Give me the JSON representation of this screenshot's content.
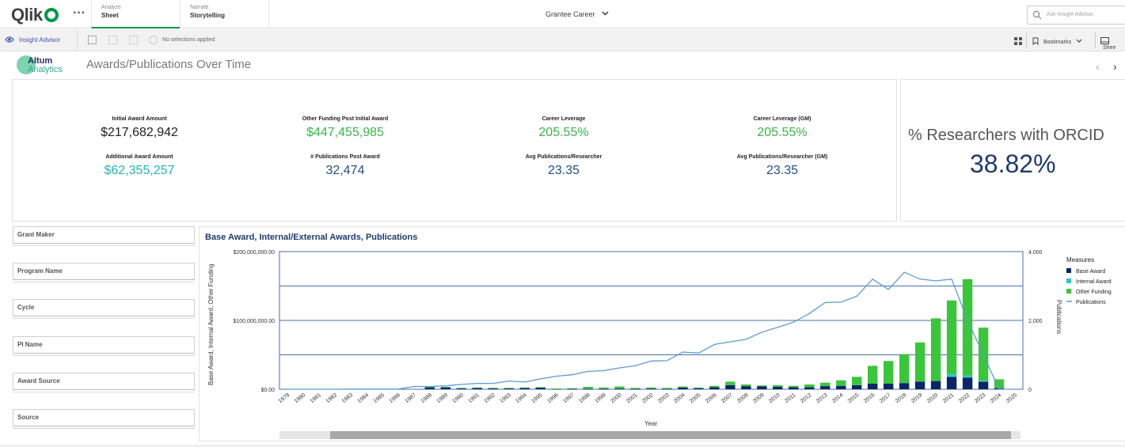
{
  "topbar": {
    "logo": "Qlik",
    "tabs": [
      {
        "small": "Analyze",
        "big": "Sheet"
      },
      {
        "small": "Narrate",
        "big": "Storytelling"
      }
    ],
    "app_title": "Grantee Career",
    "search_placeholder": "Ask Insight Advisor"
  },
  "toolbar": {
    "insight_advisor": "Insight Advisor",
    "no_selections": "No selections applied",
    "bookmarks": "Bookmarks",
    "sheets": "Shee"
  },
  "header": {
    "brand_line1": "Altum",
    "brand_line2": "Analytics",
    "sheet_title": "Awards/Publications Over Time"
  },
  "kpis": [
    {
      "label": "Initial Award Amount",
      "value": "$217,682,942",
      "color": "#222222"
    },
    {
      "label": "Other Funding Post Initial Award",
      "value": "$447,455,985",
      "color": "#3cb44b"
    },
    {
      "label": "Career Leverage",
      "value": "205.55%",
      "color": "#3cb44b"
    },
    {
      "label": "Career Leverage (GM)",
      "value": "205.55%",
      "color": "#3cb44b"
    },
    {
      "label": "Additional Award Amount",
      "value": "$62,355,257",
      "color": "#26b3b3"
    },
    {
      "label": "# Publications Post Award",
      "value": "32,474",
      "color": "#1f4e8c"
    },
    {
      "label": "Avg Publications/Researcher",
      "value": "23.35",
      "color": "#1f4e8c"
    },
    {
      "label": "Avg Publications/Researcher (GM)",
      "value": "23.35",
      "color": "#1f4e8c"
    }
  ],
  "orcid": {
    "label": "% Researchers with ORCID",
    "value": "38.82%"
  },
  "filters": [
    "Grant Maker",
    "Program Name",
    "Cycle",
    "PI Name",
    "Award Source",
    "Source"
  ],
  "chart_data": {
    "type": "bar",
    "title": "Base Award, Internal/External Awards, Publications",
    "xlabel": "Year",
    "ylabel": "Base Award, Internal Award, Other Funding",
    "y2label": "Publications",
    "y_ticks": [
      "$0.00",
      "$100,000,000.00",
      "$200,000,000.00"
    ],
    "y2_ticks": [
      "0",
      "2,000",
      "4,000"
    ],
    "ylim": [
      0,
      200000000
    ],
    "y2lim": [
      0,
      4000
    ],
    "legend_title": "Measures",
    "legend_position": "right",
    "categories": [
      "1979",
      "1980",
      "1981",
      "1982",
      "1983",
      "1984",
      "1985",
      "1986",
      "1987",
      "1988",
      "1989",
      "1990",
      "1991",
      "1992",
      "1993",
      "1994",
      "1995",
      "1996",
      "1997",
      "1998",
      "1999",
      "2000",
      "2001",
      "2002",
      "2003",
      "2004",
      "2005",
      "2006",
      "2007",
      "2008",
      "2009",
      "2010",
      "2011",
      "2012",
      "2013",
      "2014",
      "2015",
      "2016",
      "2017",
      "2018",
      "2019",
      "2020",
      "2021",
      "2022",
      "2023",
      "2024",
      "2025"
    ],
    "series": [
      {
        "name": "Base Award",
        "color": "#0b2566",
        "kind": "bar",
        "values": [
          0,
          0,
          0,
          0,
          0,
          0,
          0,
          0,
          0,
          3000000,
          3000000,
          1500000,
          2000000,
          1500000,
          1500000,
          2000000,
          2500000,
          500000,
          500000,
          500000,
          500000,
          1000000,
          500000,
          1000000,
          500000,
          2500000,
          1500000,
          3000000,
          6000000,
          4500000,
          4000000,
          3500000,
          3000000,
          3000000,
          4500000,
          5000000,
          6000000,
          8000000,
          8000000,
          9000000,
          11000000,
          12000000,
          18000000,
          17000000,
          11000000,
          1500000,
          0
        ]
      },
      {
        "name": "Internal Award",
        "color": "#2ec8c8",
        "kind": "bar",
        "values": [
          0,
          0,
          0,
          0,
          0,
          0,
          0,
          0,
          0,
          0,
          0,
          0,
          0,
          0,
          0,
          0,
          0,
          0,
          0,
          0,
          0,
          0,
          0,
          0,
          0,
          0,
          0,
          0,
          0,
          0,
          0,
          0,
          0,
          0,
          0,
          0,
          0,
          0,
          0,
          0,
          0,
          0,
          4000000,
          3000000,
          1500000,
          0,
          0
        ]
      },
      {
        "name": "Other Funding",
        "color": "#3cc53c",
        "kind": "bar",
        "values": [
          0,
          0,
          0,
          0,
          0,
          0,
          0,
          0,
          0,
          500000,
          500000,
          500000,
          500000,
          500000,
          500000,
          500000,
          500000,
          500000,
          1000000,
          3000000,
          2000000,
          3000000,
          1500000,
          1500000,
          1500000,
          1500000,
          1000000,
          2000000,
          5000000,
          2500000,
          1500000,
          2500000,
          2000000,
          4000000,
          5000000,
          8000000,
          12000000,
          26000000,
          33000000,
          42000000,
          57000000,
          91000000,
          107000000,
          140000000,
          77000000,
          13000000,
          0
        ]
      },
      {
        "name": "Publications",
        "color": "#5b9bd5",
        "kind": "line",
        "values": [
          0,
          0,
          0,
          0,
          5,
          5,
          5,
          5,
          80,
          80,
          100,
          140,
          170,
          170,
          240,
          210,
          300,
          380,
          420,
          520,
          540,
          620,
          680,
          820,
          830,
          1080,
          1050,
          1300,
          1380,
          1450,
          1660,
          1800,
          1950,
          2200,
          2520,
          2530,
          2700,
          3200,
          2900,
          3400,
          3200,
          3150,
          3200,
          2000,
          1000,
          0,
          0
        ]
      }
    ]
  }
}
